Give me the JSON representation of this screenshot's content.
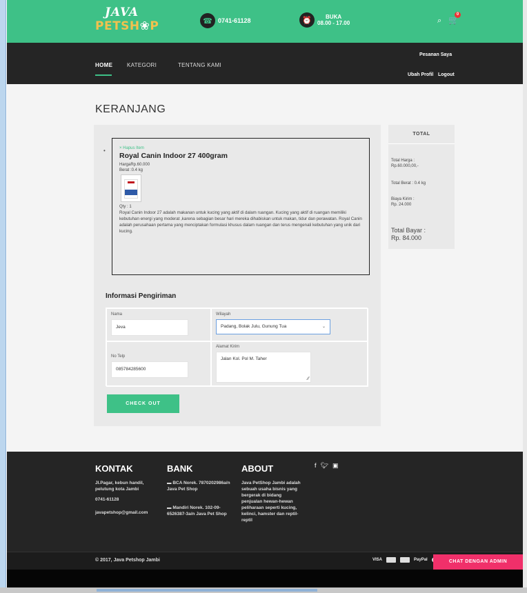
{
  "header": {
    "logo_top": "JAVA",
    "logo_bottom_a": "PETSH",
    "logo_bottom_b": "P",
    "phone": "0741-61128",
    "hours_label": "BUKA",
    "hours_value": "08.00 - 17.00",
    "cart_count": "0",
    "brand_color": "#3ec187"
  },
  "nav": {
    "items": [
      {
        "label": "HOME"
      },
      {
        "label": "KATEGORI"
      },
      {
        "label": "TENTANG KAMI"
      }
    ],
    "orders_link": "Pesanan Saya",
    "profile_link": "Ubah Profil",
    "logout_link": "Logout"
  },
  "cart": {
    "title": "KERANJANG",
    "item": {
      "remove": "× Hapus Item",
      "name": "Royal Canin Indoor 27 400gram",
      "price": "HargaRp.60.000",
      "weight": "Berat :0.4 kg",
      "qty": "Qty : 1",
      "description": "Royal Canin Indoor 27 adalah makanan untuk kucing yang aktif di dalam ruangan. Kucing yang aktif di ruangan memiliki kebutuhan energi yang moderat ,karena sebagian besar hari mereka dihabiskan untuk makan, tidur dan perawatan. Royal Canin adalah perusahaan pertama yang menciptakan formulasi khusus dalam ruangan dan terus mengenali kebutuhan yang unik dari kucing."
    }
  },
  "shipping": {
    "title": "Informasi Pengiriman",
    "name_label": "Nama",
    "name_value": "Jeva",
    "region_label": "Wilayah",
    "region_value": "Padang, Bolak Julu, Gunung Tua",
    "phone_label": "No Telp",
    "phone_value": "085784285600",
    "address_label": "Alamat Kirim",
    "address_value": "Jalan Kol. Pol M. Taher",
    "checkout": "CHECK OUT"
  },
  "summary": {
    "title": "TOTAL",
    "total_price_label": "Total Harga :",
    "total_price_value": "Rp.60.000,00,-",
    "total_weight": "Total Berat : 0.4 kg",
    "shipping_label": "Biaya Kirim :",
    "shipping_value": "Rp. 24.000",
    "pay_label": "Total Bayar :",
    "pay_value": "Rp. 84.000"
  },
  "footer": {
    "contact_title": "KONTAK",
    "contact_address": "Jl.Pagar, kebun handil, pelutung kota Jambi",
    "contact_phone": "0741-61128",
    "contact_email": "javapetshop@gmail.com",
    "bank_title": "BANK",
    "bank_1": "BCA Norek. 7870202986a/n Java Pet Shop",
    "bank_2": "Mandiri Norek. 102-09-6526387-3a/n Java Pet Shop",
    "about_title": "ABOUT",
    "about_text": "Java PetShop Jambi adalah sebuah usaha bisnis yang bergerak di bidang penjualan hewan-hewan peliharaan seperti kucing, kelinci, hamster dan reptil-reptil",
    "copyright": "© 2017, Java Petshop Jambi",
    "payment_visa": "VISA",
    "payment_paypal": "PayPal",
    "chat_button": "CHAT DENGAN ADMIN"
  }
}
